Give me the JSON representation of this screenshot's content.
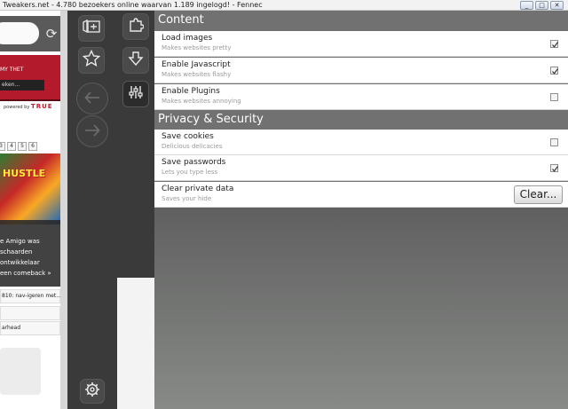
{
  "window": {
    "title": "Tweakers.net - 4.780 bezoekers online waarvan 1.189 ingelogd! - Fennec",
    "controls": [
      "_",
      "□",
      "✕"
    ]
  },
  "webpage": {
    "banner_text": "MY THET",
    "banner_select": "eken...",
    "powered_by": "powered by",
    "brand": "TRUE",
    "pages": [
      "3",
      "4",
      "5",
      "6"
    ],
    "game_title": "HUSTLE",
    "caption_lines": [
      "e Amigo was",
      "schaarden",
      "ontwikkelaar",
      "een comeback »"
    ],
    "links": [
      "810: nav-igeren met...",
      "",
      "arhead"
    ]
  },
  "settings": {
    "sections": [
      {
        "title": "Content",
        "items": [
          {
            "label": "Load images",
            "description": "Makes websites pretty",
            "checked": true
          },
          {
            "label": "Enable Javascript",
            "description": "Makes websites flashy",
            "checked": true
          },
          {
            "label": "Enable Plugins",
            "description": "Makes websites annoying",
            "checked": false
          }
        ]
      },
      {
        "title": "Privacy & Security",
        "items": [
          {
            "label": "Save cookies",
            "description": "Delicious delicacies",
            "checked": false
          },
          {
            "label": "Save passwords",
            "description": "Lets you type less",
            "checked": true
          },
          {
            "label": "Clear private data",
            "description": "Saves your hide",
            "button": "Clear..."
          }
        ]
      }
    ]
  },
  "icons": {
    "reload": "reload-icon",
    "tabs": "tabs-icon",
    "bookmark": "star-icon",
    "back": "back-arrow-icon",
    "forward": "forward-arrow-icon",
    "addons": "puzzle-icon",
    "download": "download-arrow-icon",
    "preferences": "sliders-icon",
    "settings": "gear-icon"
  },
  "colors": {
    "chrome_dark": "#3a3a3a",
    "section_header": "#707170",
    "banner_red": "#b31b2c"
  }
}
